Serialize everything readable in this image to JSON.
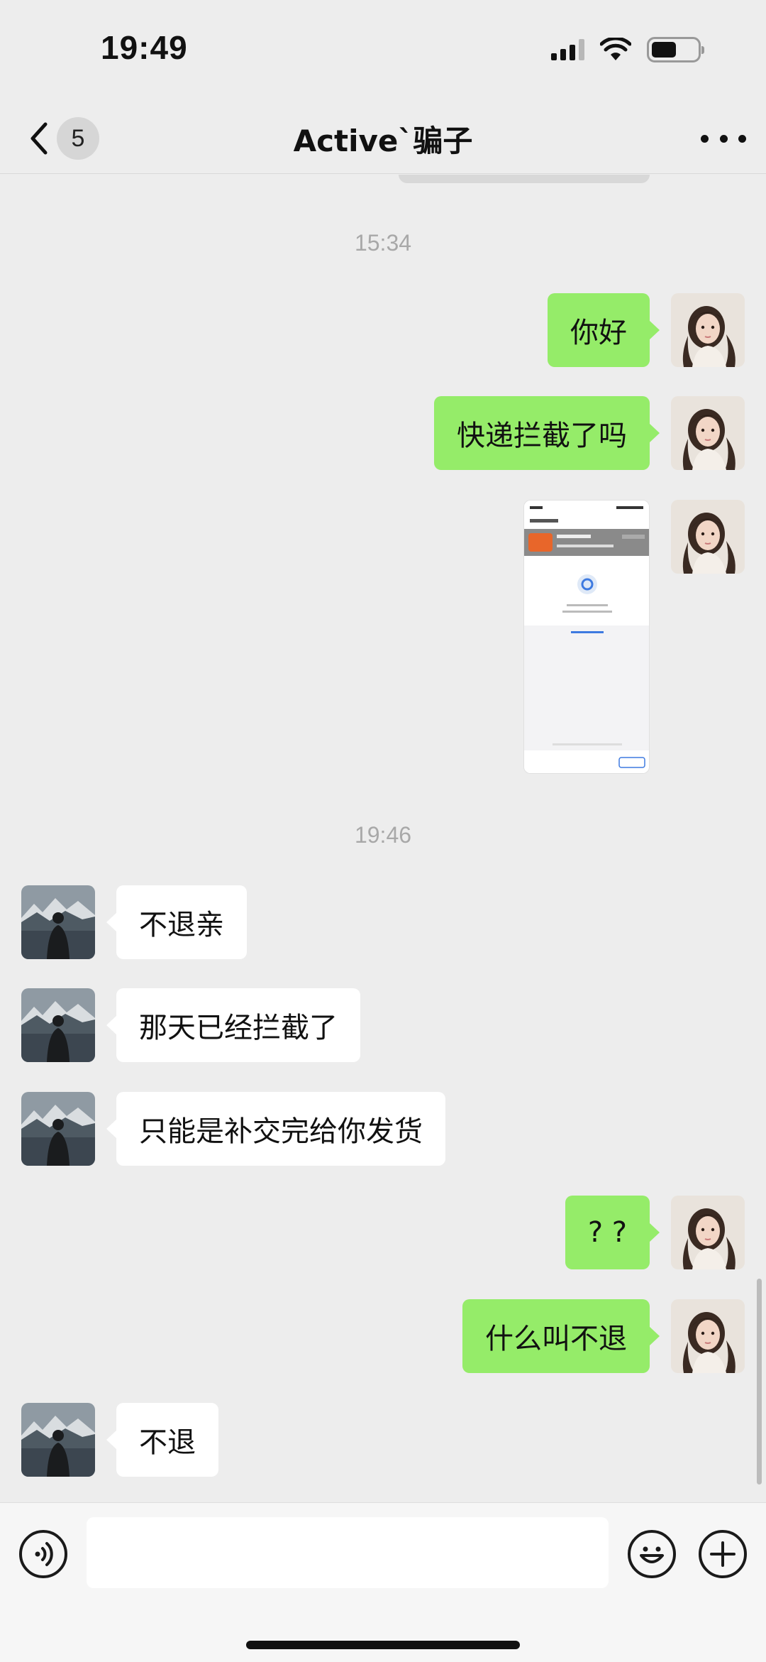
{
  "status_bar": {
    "time": "19:49",
    "battery_level": 0.55
  },
  "nav": {
    "unread_count": "5",
    "title": "Active`骗子"
  },
  "chat": {
    "messages": [
      {
        "type": "timestamp",
        "text": "15:34"
      },
      {
        "type": "text",
        "side": "out",
        "text": "你好"
      },
      {
        "type": "text",
        "side": "out",
        "text": "快递拦截了吗"
      },
      {
        "type": "image",
        "side": "out",
        "icon": "screenshot-image"
      },
      {
        "type": "timestamp",
        "text": "19:46"
      },
      {
        "type": "text",
        "side": "in",
        "text": "不退亲"
      },
      {
        "type": "text",
        "side": "in",
        "text": "那天已经拦截了"
      },
      {
        "type": "text",
        "side": "in",
        "text": "只能是补交完给你发货"
      },
      {
        "type": "text",
        "side": "out",
        "text": "? ?"
      },
      {
        "type": "text",
        "side": "out",
        "text": "什么叫不退"
      },
      {
        "type": "text",
        "side": "in",
        "text": "不退"
      }
    ]
  },
  "input_bar": {
    "value": "",
    "placeholder": ""
  },
  "colors": {
    "background": "#ededed",
    "outgoing_bubble": "#95ec69",
    "incoming_bubble": "#ffffff",
    "timestamp": "#a8a8a8"
  },
  "icons": {
    "back": "chevron-left-icon",
    "more": "more-dots-icon",
    "voice": "voice-icon",
    "emoji": "emoji-icon",
    "plus": "plus-icon"
  }
}
